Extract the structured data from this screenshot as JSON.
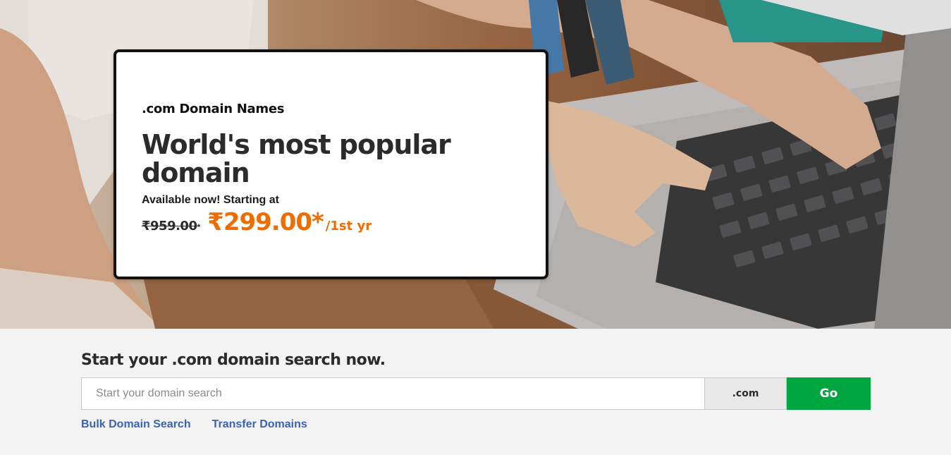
{
  "hero": {
    "image_alt": "hands-typing-on-laptop-photo",
    "card": {
      "eyebrow": ".com Domain Names",
      "headline": "World's most popular domain",
      "availability": "Available now! Starting at",
      "price_old": "₹959.00",
      "price_old_asterisk": "*",
      "price_new": "₹299.00",
      "price_new_asterisk": "*",
      "price_term": "/1st yr"
    }
  },
  "search": {
    "heading": "Start your .com domain search now.",
    "input_placeholder": "Start your domain search",
    "tld": ".com",
    "go_label": "Go",
    "links": [
      {
        "label": "Bulk Domain Search"
      },
      {
        "label": "Transfer Domains"
      }
    ]
  },
  "colors": {
    "accent_orange": "#ef6c00",
    "go_green": "#00a63f",
    "link_blue": "#3a63b3",
    "section_bg": "#f3f3f3"
  }
}
